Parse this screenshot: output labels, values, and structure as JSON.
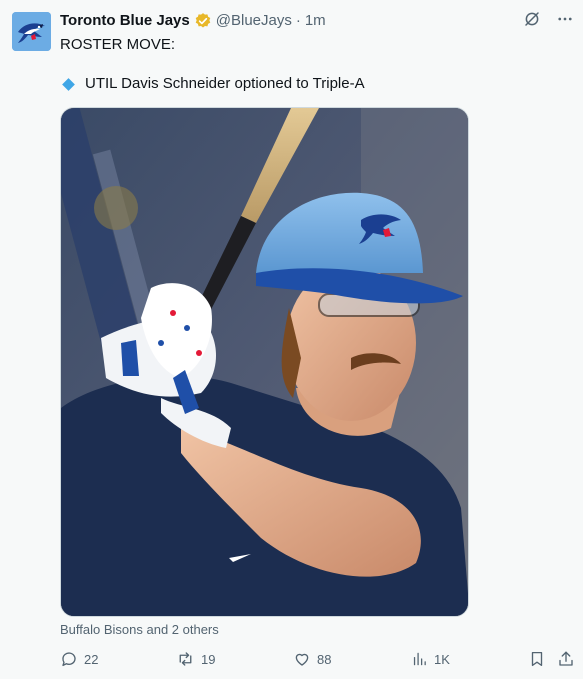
{
  "account": {
    "display_name": "Toronto Blue Jays",
    "handle": "@BlueJays",
    "separator": "·",
    "timestamp": "1m"
  },
  "tweet": {
    "line1": "ROSTER MOVE:",
    "line2": "UTIL Davis Schneider optioned to Triple-A"
  },
  "media": {
    "tagged_text": "Buffalo Bisons and 2 others"
  },
  "metrics": {
    "replies": "22",
    "reposts": "19",
    "likes": "88",
    "views": "1K"
  },
  "colors": {
    "verified": "#e8b829",
    "accent": "#1d9bf0",
    "cap_light": "#6ea8dc",
    "cap_brim": "#1f4fa8",
    "shirt": "#1c2d50"
  },
  "icons": [
    "grok-icon",
    "more-icon",
    "reply-icon",
    "repost-icon",
    "like-icon",
    "views-icon",
    "bookmark-icon",
    "share-icon"
  ]
}
